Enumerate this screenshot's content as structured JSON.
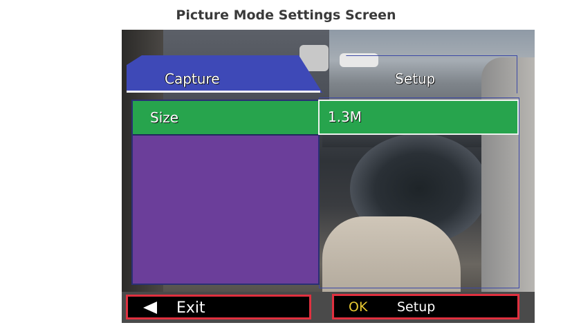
{
  "page_heading": "Picture Mode Settings Screen",
  "tabs": {
    "capture": "Capture",
    "setup": "Setup"
  },
  "menu": {
    "selected_item": "Size",
    "selected_value": "1.3M"
  },
  "footer": {
    "exit_label": "Exit",
    "ok_label": "OK",
    "setup_label": "Setup"
  },
  "colors": {
    "tab_active": "#3e49b7",
    "panel_left": "#6b3e9a",
    "row_selected": "#27a44d",
    "button_border": "#e0303f",
    "ok_text": "#e7c832"
  },
  "icons": {
    "exit": "left-triangle-icon"
  }
}
